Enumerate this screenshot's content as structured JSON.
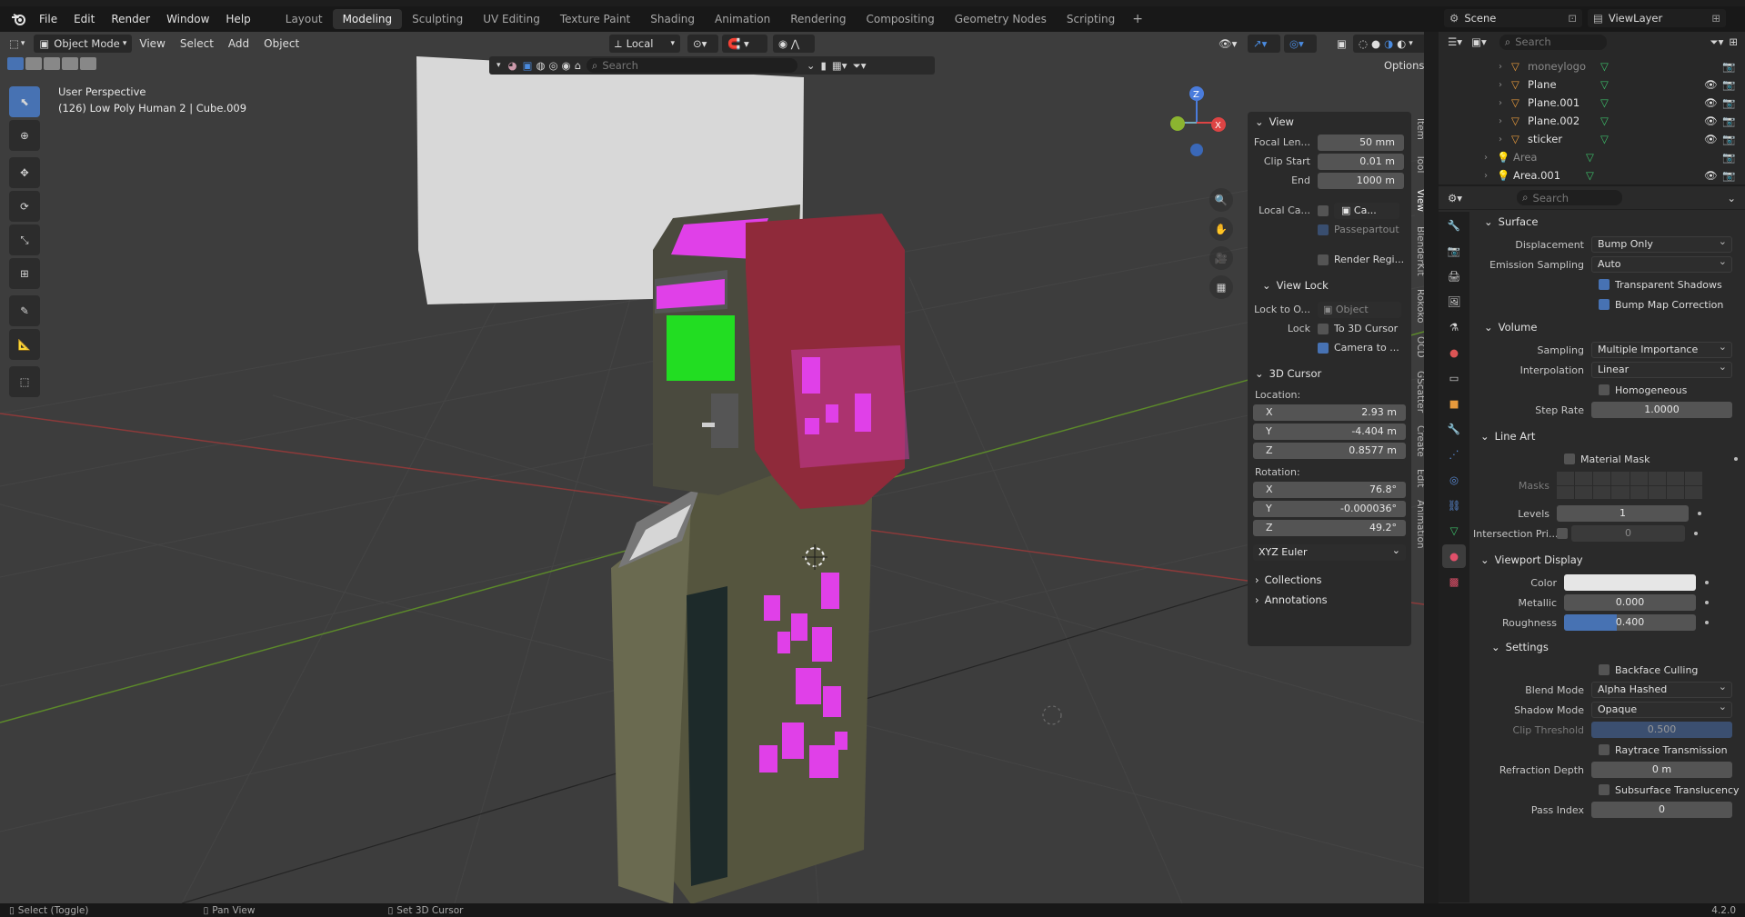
{
  "menu": {
    "items": [
      "File",
      "Edit",
      "Render",
      "Window",
      "Help"
    ]
  },
  "workspaces": [
    "Layout",
    "Modeling",
    "Sculpting",
    "UV Editing",
    "Texture Paint",
    "Shading",
    "Animation",
    "Rendering",
    "Compositing",
    "Geometry Nodes",
    "Scripting"
  ],
  "active_workspace": "Modeling",
  "scene": {
    "name": "Scene",
    "view_layer": "ViewLayer"
  },
  "viewport": {
    "mode": "Object Mode",
    "menus": [
      "View",
      "Select",
      "Add",
      "Object"
    ],
    "transform_orientation": "Local",
    "search_placeholder": "Search",
    "options_label": "Options",
    "info_line1": "User Perspective",
    "info_line2": "(126) Low Poly Human 2 | Cube.009"
  },
  "npanel": {
    "view_title": "View",
    "focal_length_label": "Focal Len...",
    "focal_length": "50 mm",
    "clip_start_label": "Clip Start",
    "clip_start": "0.01 m",
    "clip_end_label": "End",
    "clip_end": "1000 m",
    "local_camera_label": "Local Ca...",
    "local_camera_value": "Ca...",
    "passepartout": "Passepartout",
    "render_region": "Render Regi...",
    "view_lock_title": "View Lock",
    "lock_to_object_label": "Lock to O...",
    "lock_to_object_value": "Object",
    "lock_label": "Lock",
    "to_3d_cursor": "To 3D Cursor",
    "camera_to": "Camera to ...",
    "cursor_title": "3D Cursor",
    "location_label": "Location:",
    "loc_x": "2.93 m",
    "loc_y": "-4.404 m",
    "loc_z": "0.8577 m",
    "rotation_label": "Rotation:",
    "rot_x": "76.8°",
    "rot_y": "-0.000036°",
    "rot_z": "49.2°",
    "rotation_mode": "XYZ Euler",
    "collections": "Collections",
    "annotations": "Annotations",
    "axis_x": "X",
    "axis_y": "Y",
    "axis_z": "Z",
    "tabs": [
      "Item",
      "Tool",
      "View",
      "BlenderKit",
      "Rokoko",
      "OCD",
      "GScatter",
      "Create",
      "Edit",
      "Animation"
    ]
  },
  "outliner": {
    "search_placeholder": "Search",
    "rows": [
      {
        "name": "moneylogo",
        "dim": true
      },
      {
        "name": "Plane",
        "dim": false
      },
      {
        "name": "Plane.001",
        "dim": false
      },
      {
        "name": "Plane.002",
        "dim": false
      },
      {
        "name": "sticker",
        "dim": false
      },
      {
        "name": "Area",
        "dim": true
      },
      {
        "name": "Area.001",
        "dim": false
      }
    ]
  },
  "properties": {
    "search_placeholder": "Search",
    "surface_title": "Surface",
    "displacement_label": "Displacement",
    "displacement": "Bump Only",
    "emission_sampling_label": "Emission Sampling",
    "emission_sampling": "Auto",
    "transparent_shadows": "Transparent Shadows",
    "bump_map_correction": "Bump Map Correction",
    "volume_title": "Volume",
    "sampling_label": "Sampling",
    "sampling": "Multiple Importance",
    "interpolation_label": "Interpolation",
    "interpolation": "Linear",
    "homogeneous": "Homogeneous",
    "step_rate_label": "Step Rate",
    "step_rate": "1.0000",
    "line_art_title": "Line Art",
    "material_mask": "Material Mask",
    "masks_label": "Masks",
    "levels_label": "Levels",
    "levels": "1",
    "intersection_label": "Intersection Pri...",
    "intersection": "0",
    "viewport_display_title": "Viewport Display",
    "color_label": "Color",
    "metallic_label": "Metallic",
    "metallic": "0.000",
    "roughness_label": "Roughness",
    "roughness": "0.400",
    "roughness_level": 0.4,
    "settings_title": "Settings",
    "backface_culling": "Backface Culling",
    "blend_mode_label": "Blend Mode",
    "blend_mode": "Alpha Hashed",
    "shadow_mode_label": "Shadow Mode",
    "shadow_mode": "Opaque",
    "clip_threshold_label": "Clip Threshold",
    "clip_threshold": "0.500",
    "raytrace_transmission": "Raytrace Transmission",
    "refraction_depth_label": "Refraction Depth",
    "refraction_depth": "0 m",
    "subsurface_translucency": "Subsurface Translucency",
    "pass_index_label": "Pass Index",
    "pass_index": "0"
  },
  "statusbar": {
    "select": "Select (Toggle)",
    "pan": "Pan View",
    "cursor": "Set 3D Cursor",
    "version": "4.2.0"
  },
  "colors": {
    "accent": "#4772b3",
    "magenta": "#e040e8",
    "green_screen": "#22dd22",
    "body": "#5a5a4a"
  }
}
